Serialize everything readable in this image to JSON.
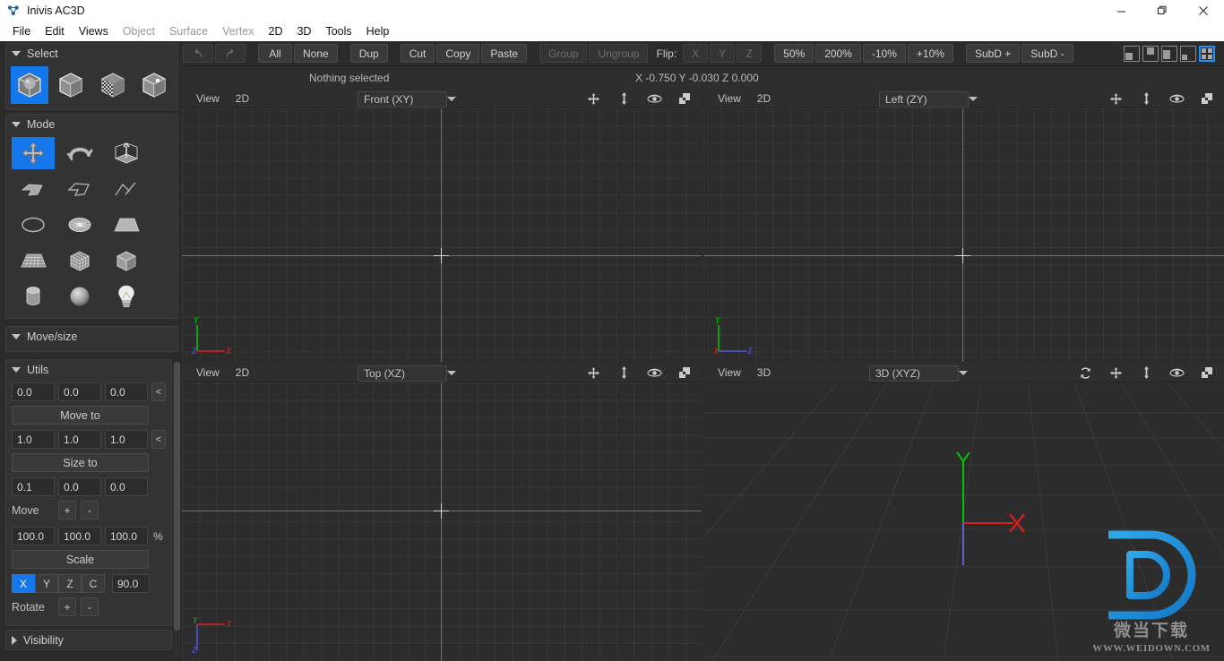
{
  "window": {
    "title": "Inivis AC3D",
    "logo_icon": "ac3d-logo-icon",
    "minimize_label": "—",
    "maximize_label": "❐",
    "close_label": "✕"
  },
  "menubar": {
    "items": [
      {
        "label": "File",
        "enabled": true
      },
      {
        "label": "Edit",
        "enabled": true
      },
      {
        "label": "Views",
        "enabled": true
      },
      {
        "label": "Object",
        "enabled": false
      },
      {
        "label": "Surface",
        "enabled": false
      },
      {
        "label": "Vertex",
        "enabled": false
      },
      {
        "label": "2D",
        "enabled": true
      },
      {
        "label": "3D",
        "enabled": true
      },
      {
        "label": "Tools",
        "enabled": true
      },
      {
        "label": "Help",
        "enabled": true
      }
    ]
  },
  "toolbar": {
    "undo_label": "↶",
    "redo_label": "↷",
    "all_label": "All",
    "none_label": "None",
    "dup_label": "Dup",
    "cut_label": "Cut",
    "copy_label": "Copy",
    "paste_label": "Paste",
    "group_label": "Group",
    "ungroup_label": "Ungroup",
    "flip_label": "Flip:",
    "flip_x_label": "X",
    "flip_y_label": "Y",
    "flip_z_label": "Z",
    "zoom50_label": "50%",
    "zoom200_label": "200%",
    "zoom_minus10_label": "-10%",
    "zoom_plus10_label": "+10%",
    "subd_plus_label": "SubD +",
    "subd_minus_label": "SubD -",
    "layout_active_index": 4,
    "accent_color": "#1478ec"
  },
  "status": {
    "selection": "Nothing selected",
    "coordinates": "X -0.750 Y -0.030 Z 0.000"
  },
  "sidebar": {
    "select_panel": {
      "title": "Select",
      "expanded": true,
      "items": [
        {
          "name": "select-group-icon",
          "label": "Group",
          "active": true
        },
        {
          "name": "select-object-icon",
          "label": "Object",
          "active": false
        },
        {
          "name": "select-surface-icon",
          "label": "Surface",
          "active": false
        },
        {
          "name": "select-vertex-icon",
          "label": "Vertex",
          "active": false
        }
      ]
    },
    "mode_panel": {
      "title": "Mode",
      "expanded": true,
      "items": [
        {
          "name": "move-tool-icon",
          "label": "Move",
          "active": true
        },
        {
          "name": "rotate-tool-icon",
          "label": "Rotate",
          "active": false
        },
        {
          "name": "extrude-tool-icon",
          "label": "Extrude",
          "active": false
        },
        {
          "name": "polygon-tool-icon",
          "label": "Polygon",
          "active": false
        },
        {
          "name": "line-tool-icon",
          "label": "Line",
          "active": false
        },
        {
          "name": "polyline-tool-icon",
          "label": "Polyline",
          "active": false
        },
        {
          "name": "circle-tool-icon",
          "label": "Circle",
          "active": false
        },
        {
          "name": "disc-tool-icon",
          "label": "Disc",
          "active": false
        },
        {
          "name": "plane-tool-icon",
          "label": "Plane",
          "active": false
        },
        {
          "name": "mesh-tool-icon",
          "label": "Mesh",
          "active": false
        },
        {
          "name": "subdivcube-tool-icon",
          "label": "Subdiv Cube",
          "active": false
        },
        {
          "name": "box-tool-icon",
          "label": "Box",
          "active": false
        },
        {
          "name": "cylinder-tool-icon",
          "label": "Cylinder",
          "active": false
        },
        {
          "name": "sphere-tool-icon",
          "label": "Sphere",
          "active": false
        },
        {
          "name": "light-tool-icon",
          "label": "Light",
          "active": false
        }
      ]
    },
    "movesize_panel": {
      "title": "Move/size",
      "expanded": true
    },
    "utils_panel": {
      "title": "Utils",
      "expanded": true,
      "move_to": {
        "x": "0.0",
        "y": "0.0",
        "z": "0.0",
        "pick_label": "<",
        "button_label": "Move to"
      },
      "size_to": {
        "x": "1.0",
        "y": "1.0",
        "z": "1.0",
        "pick_label": "<",
        "button_label": "Size to"
      },
      "move_by": {
        "x": "0.1",
        "y": "0.0",
        "z": "0.0",
        "label": "Move",
        "plus_label": "+",
        "minus_label": "-"
      },
      "scale": {
        "x": "100.0",
        "y": "100.0",
        "z": "100.0",
        "unit": "%",
        "button_label": "Scale"
      },
      "rotate": {
        "axes": [
          {
            "label": "X",
            "active": true
          },
          {
            "label": "Y",
            "active": false
          },
          {
            "label": "Z",
            "active": false
          },
          {
            "label": "C",
            "active": false
          }
        ],
        "angle": "90.0",
        "label": "Rotate",
        "plus_label": "+",
        "minus_label": "-"
      }
    },
    "visibility_panel": {
      "title": "Visibility",
      "expanded": false
    }
  },
  "viewports": [
    {
      "name": "viewport-front",
      "view_label": "View",
      "mode_label": "2D",
      "projection": "Front (XY)",
      "icons": [
        "pan-icon",
        "zoom-icon",
        "eye-icon",
        "maximize-icon"
      ],
      "gizmo": {
        "up": "Y",
        "right": "X",
        "origin": "Z"
      }
    },
    {
      "name": "viewport-left",
      "view_label": "View",
      "mode_label": "2D",
      "projection": "Left (ZY)",
      "icons": [
        "pan-icon",
        "zoom-icon",
        "eye-icon",
        "maximize-icon"
      ],
      "gizmo": {
        "up": "Y",
        "right": "Z",
        "origin": "X"
      }
    },
    {
      "name": "viewport-top",
      "view_label": "View",
      "mode_label": "2D",
      "projection": "Top (XZ)",
      "icons": [
        "pan-icon",
        "zoom-icon",
        "eye-icon",
        "maximize-icon"
      ],
      "gizmo": {
        "up": "Y",
        "right": "X",
        "down": "Z"
      }
    },
    {
      "name": "viewport-3d",
      "view_label": "View",
      "mode_label": "3D",
      "projection": "3D (XYZ)",
      "icons": [
        "refresh-icon",
        "pan-icon",
        "zoom-icon",
        "eye-icon",
        "maximize-icon"
      ],
      "gizmo": {
        "up": "Y",
        "right": "X",
        "down": "Z"
      }
    }
  ],
  "watermark": {
    "logo_letter": "D",
    "chinese": "微当下载",
    "url": "WWW.WEIDOWN.COM",
    "color": "#2196d8"
  },
  "colors": {
    "axis_x": "#d81f1f",
    "axis_y": "#00c400",
    "axis_z": "#5555dd",
    "accent": "#1478ec",
    "panel_bg": "#333333",
    "app_bg": "#2b2b2b",
    "canvas_bg": "#2c2c2c"
  }
}
